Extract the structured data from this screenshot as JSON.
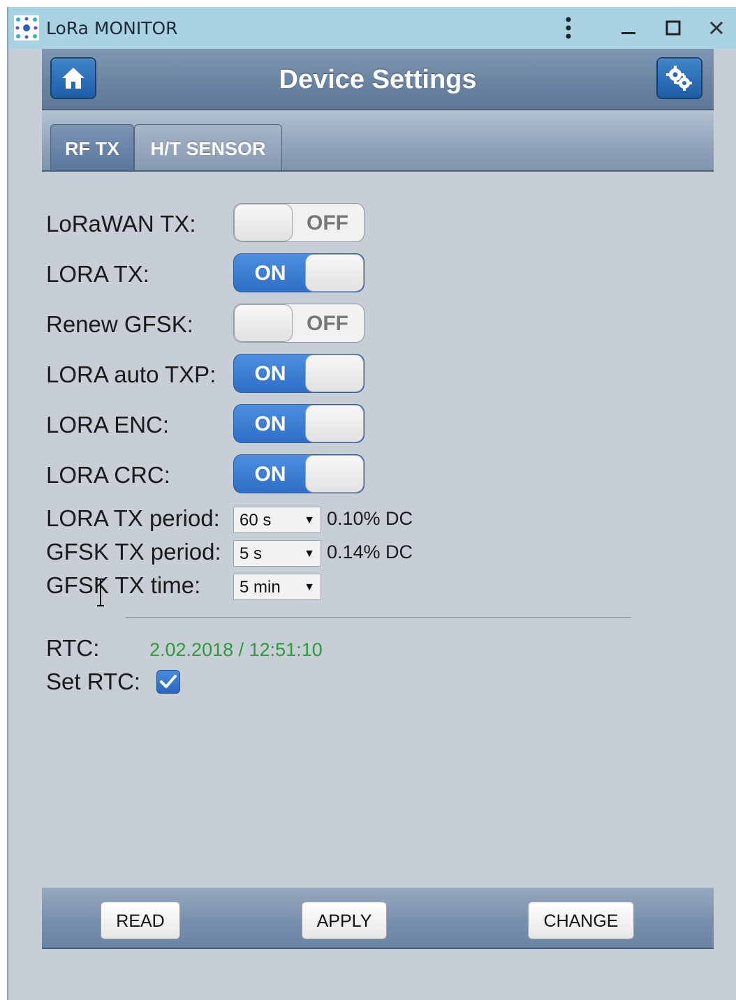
{
  "window": {
    "title": "LoRa MONITOR"
  },
  "header": {
    "title": "Device Settings"
  },
  "tabs": [
    {
      "label": "RF TX",
      "active": true
    },
    {
      "label": "H/T SENSOR",
      "active": false
    }
  ],
  "toggles": [
    {
      "label": "LoRaWAN TX:",
      "state": "OFF"
    },
    {
      "label": "LORA TX:",
      "state": "ON"
    },
    {
      "label": "Renew GFSK:",
      "state": "OFF"
    },
    {
      "label": "LORA auto TXP:",
      "state": "ON"
    },
    {
      "label": "LORA ENC:",
      "state": "ON"
    },
    {
      "label": "LORA CRC:",
      "state": "ON"
    }
  ],
  "selects": [
    {
      "label": "LORA TX period:",
      "value": "60 s",
      "dc": "0.10% DC"
    },
    {
      "label": "GFSK TX period:",
      "value": "5 s",
      "dc": "0.14% DC"
    },
    {
      "label": "GFSK TX time:",
      "value": "5 min",
      "dc": ""
    }
  ],
  "rtc": {
    "label": "RTC:",
    "value": "2.02.2018 / 12:51:10",
    "set_label": "Set RTC:",
    "set_checked": true
  },
  "footer": {
    "read_label": "READ",
    "apply_label": "APPLY",
    "change_label": "CHANGE"
  },
  "colors": {
    "accent_blue": "#2f6fc6",
    "rtc_green": "#2e9a3b",
    "titlebar": "#a9d2e3",
    "background": "#c8ced6"
  }
}
